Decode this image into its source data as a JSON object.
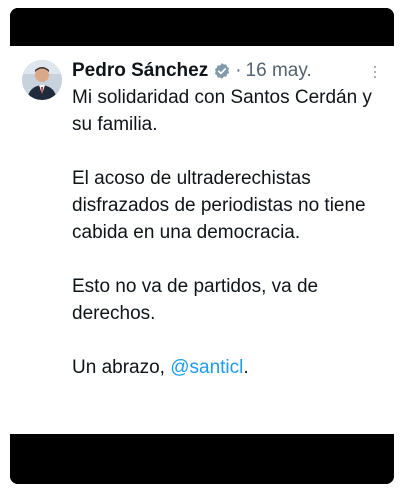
{
  "tweet": {
    "author_name": "Pedro Sánchez",
    "separator": "·",
    "date": "16 may.",
    "paragraph_1": "Mi solidaridad con Santos Cerdán y su familia.",
    "paragraph_2": "El acoso de ultraderechistas disfrazados de periodistas no tiene cabida en una democracia.",
    "paragraph_3": "Esto no va de partidos, va de derechos.",
    "closing_prefix": "Un abrazo, ",
    "mention": "@santicl",
    "closing_suffix": "."
  },
  "icons": {
    "verified": "verified-badge-icon",
    "more": "more-options-icon",
    "avatar": "profile-photo"
  },
  "colors": {
    "background_frame": "#000000",
    "card": "#ffffff",
    "text": "#0f1419",
    "secondary": "#536471",
    "link": "#1d9bf0",
    "verified_badge": "#829aab"
  }
}
